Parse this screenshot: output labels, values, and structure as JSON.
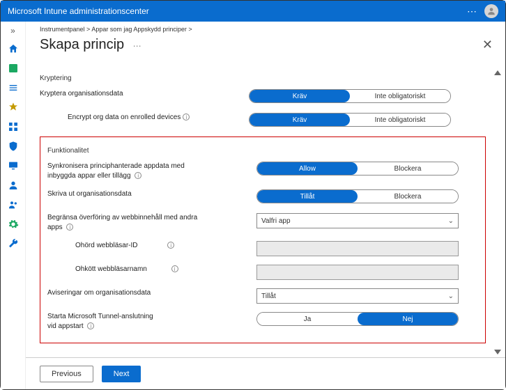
{
  "topbar": {
    "title": "Microsoft Intune administrationscenter"
  },
  "breadcrumb": {
    "prefix": "Instrumentpanel >",
    "trail": "Appar som jag Appskydd principer >"
  },
  "blade": {
    "title": "Skapa princip"
  },
  "sections": {
    "encryption": {
      "heading": "Kryptering",
      "encrypt_org_data": {
        "label": "Kryptera organisationsdata",
        "opt_required": "Kräv",
        "opt_notreq": "Inte obligatoriskt"
      },
      "encrypt_enrolled": {
        "label": "Encrypt org data on enrolled devices",
        "opt_required": "Kräv",
        "opt_notreq": "Inte obligatoriskt"
      }
    },
    "functionality": {
      "heading": "Funktionalitet",
      "sync": {
        "label_line1": "Synkronisera principhanterade appdata med",
        "label_line2": "inbyggda appar eller tillägg",
        "opt_allow": "Allow",
        "opt_block": "Blockera"
      },
      "print": {
        "label": "Skriva ut organisationsdata",
        "opt_allow": "Tillåt",
        "opt_block": "Blockera"
      },
      "restrict_web": {
        "label_line1": "Begränsa överföring av webbinnehåll med andra",
        "label_line2": "apps",
        "select_value": "Valfri app"
      },
      "unheard_id": {
        "label": "Ohörd webbläsar-ID"
      },
      "unheard_name": {
        "label": "Ohkött webbläsarnamn"
      },
      "notify": {
        "label": "Aviseringar om organisationsdata",
        "select_value": "Tillåt"
      },
      "tunnel": {
        "label_line1": "Starta Microsoft Tunnel-anslutning",
        "label_line2": "vid appstart",
        "opt_yes": "Ja",
        "opt_no": "Nej"
      }
    }
  },
  "footer": {
    "previous": "Previous",
    "next": "Next"
  }
}
